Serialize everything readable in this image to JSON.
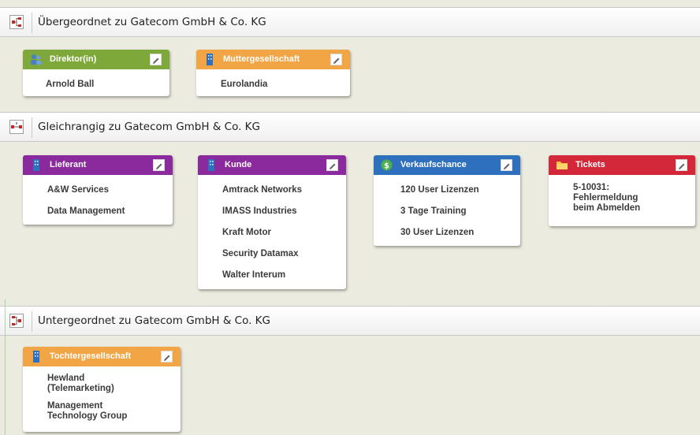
{
  "sections": [
    {
      "title": "Übergeordnet zu Gatecom GmbH & Co. KG"
    },
    {
      "title": "Gleichrangig zu Gatecom GmbH & Co. KG"
    },
    {
      "title": "Untergeordnet zu Gatecom GmbH & Co. KG"
    }
  ],
  "cards": {
    "direktor": {
      "label": "Direktor(in)",
      "items": [
        "Arnold Ball"
      ],
      "color": "#7ea83a",
      "icon": "person-icon"
    },
    "mutter": {
      "label": "Muttergesellschaft",
      "items": [
        "Eurolandia"
      ],
      "color": "#f2a545",
      "icon": "building-icon"
    },
    "lieferant": {
      "label": "Lieferant",
      "items": [
        "A&W Services",
        "Data Management"
      ],
      "color": "#8a2a9c",
      "icon": "building-icon"
    },
    "kunde": {
      "label": "Kunde",
      "items": [
        "Amtrack Networks",
        "IMASS Industries",
        "Kraft Motor",
        "Security Datamax",
        "Walter Interum"
      ],
      "color": "#8a2a9c",
      "icon": "building-icon"
    },
    "verkauf": {
      "label": "Verkaufschance",
      "items": [
        "120 User Lizenzen",
        "3 Tage Training",
        "30 User Lizenzen"
      ],
      "color": "#2e6fbe",
      "icon": "dollar-icon"
    },
    "tickets": {
      "label": "Tickets",
      "items": [
        "5-10031:\nFehlermeldung\nbeim Abmelden"
      ],
      "color": "#d2283a",
      "icon": "folder-icon"
    },
    "tochter": {
      "label": "Tochtergesellschaft",
      "items": [
        "Hewland\n(Telemarketing)",
        "Management\nTechnology Group"
      ],
      "color": "#f2a545",
      "icon": "building-icon"
    }
  }
}
